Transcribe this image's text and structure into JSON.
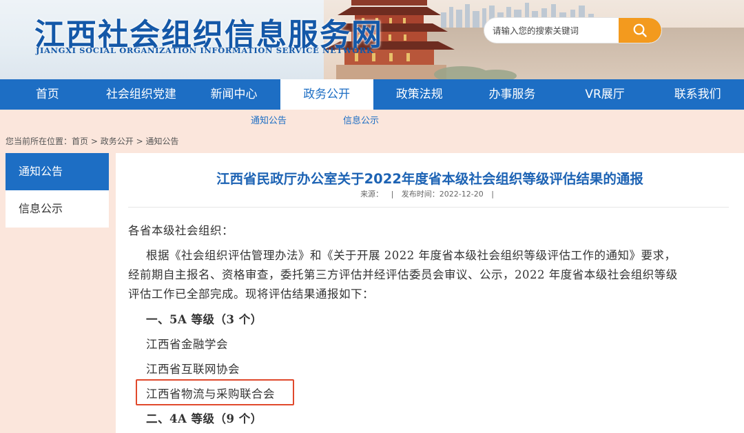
{
  "header": {
    "site_title": "江西社会组织信息服务网",
    "site_subtitle": "JIANGXI SOCIAL ORGANIZATION INFORMATION SERVICE NETWORK",
    "search_placeholder": "请输入您的搜索关键词",
    "search_icon": "search-icon"
  },
  "nav": {
    "items": [
      {
        "label": "首页"
      },
      {
        "label": "社会组织党建"
      },
      {
        "label": "新闻中心"
      },
      {
        "label": "政务公开"
      },
      {
        "label": "政策法规"
      },
      {
        "label": "办事服务"
      },
      {
        "label": "VR展厅"
      },
      {
        "label": "联系我们"
      }
    ],
    "active_index": 3
  },
  "subnav": {
    "items": [
      {
        "label": "通知公告"
      },
      {
        "label": "信息公示"
      }
    ]
  },
  "breadcrumb": {
    "prefix": "您当前所在位置：",
    "items": [
      "首页",
      "政务公开",
      "通知公告"
    ],
    "separator": ">"
  },
  "sidebar": {
    "items": [
      {
        "label": "通知公告",
        "active": true
      },
      {
        "label": "信息公示",
        "active": false
      }
    ]
  },
  "article": {
    "title": "江西省民政厅办公室关于2022年度省本级社会组织等级评估结果的通报",
    "source_label": "来源：",
    "publish_label": "发布时间：2022-12-20",
    "meta_sep": "|",
    "salutation": "各省本级社会组织：",
    "paragraph_lines": [
      "根据《社会组织评估管理办法》和《关于开展 2022 年度省本级社会组织等级评估工作的通知》要求，",
      "经前期自主报名、资格审查，委托第三方评估并经评估委员会审议、公示，2022 年度省本级社会组织等级",
      "评估工作已全部完成。现将评估结果通报如下："
    ],
    "section1_heading": "一、5A 等级（3 个）",
    "section1_items": [
      "江西省金融学会",
      "江西省互联网协会",
      "江西省物流与采购联合会"
    ],
    "section2_heading": "二、4A 等级（9 个）"
  },
  "colors": {
    "brand_blue": "#1d6ec4",
    "title_blue": "#1d63b4",
    "search_orange": "#f39a1e",
    "page_bg": "#fbe6dc",
    "highlight_red": "#e0482b"
  }
}
